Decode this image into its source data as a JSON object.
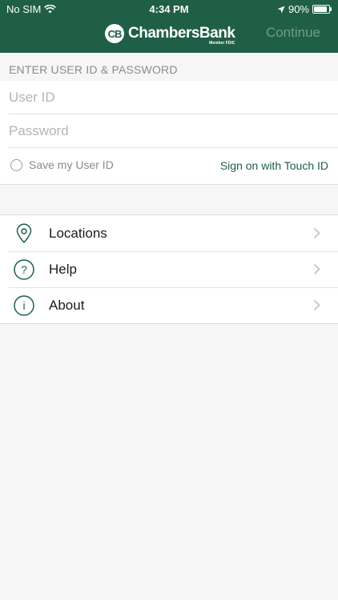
{
  "status_bar": {
    "carrier": "No SIM",
    "time": "4:34 PM",
    "battery": "90%",
    "battery_level": 0.9
  },
  "header": {
    "logo_mark": "CB",
    "logo_text": "ChambersBank",
    "logo_subtext": "Member FDIC",
    "continue_label": "Continue"
  },
  "login": {
    "section_title": "ENTER USER ID & PASSWORD",
    "user_id_placeholder": "User ID",
    "password_placeholder": "Password",
    "save_user_id_label": "Save my User ID",
    "touch_id_label": "Sign on with Touch ID"
  },
  "menu": {
    "items": [
      {
        "label": "Locations",
        "icon": "location-pin-icon"
      },
      {
        "label": "Help",
        "icon": "question-circle-icon"
      },
      {
        "label": "About",
        "icon": "info-circle-icon"
      }
    ]
  },
  "colors": {
    "brand_green": "#1f5f47",
    "continue_disabled": "#6f9c8b",
    "background": "#f7f6f7"
  }
}
